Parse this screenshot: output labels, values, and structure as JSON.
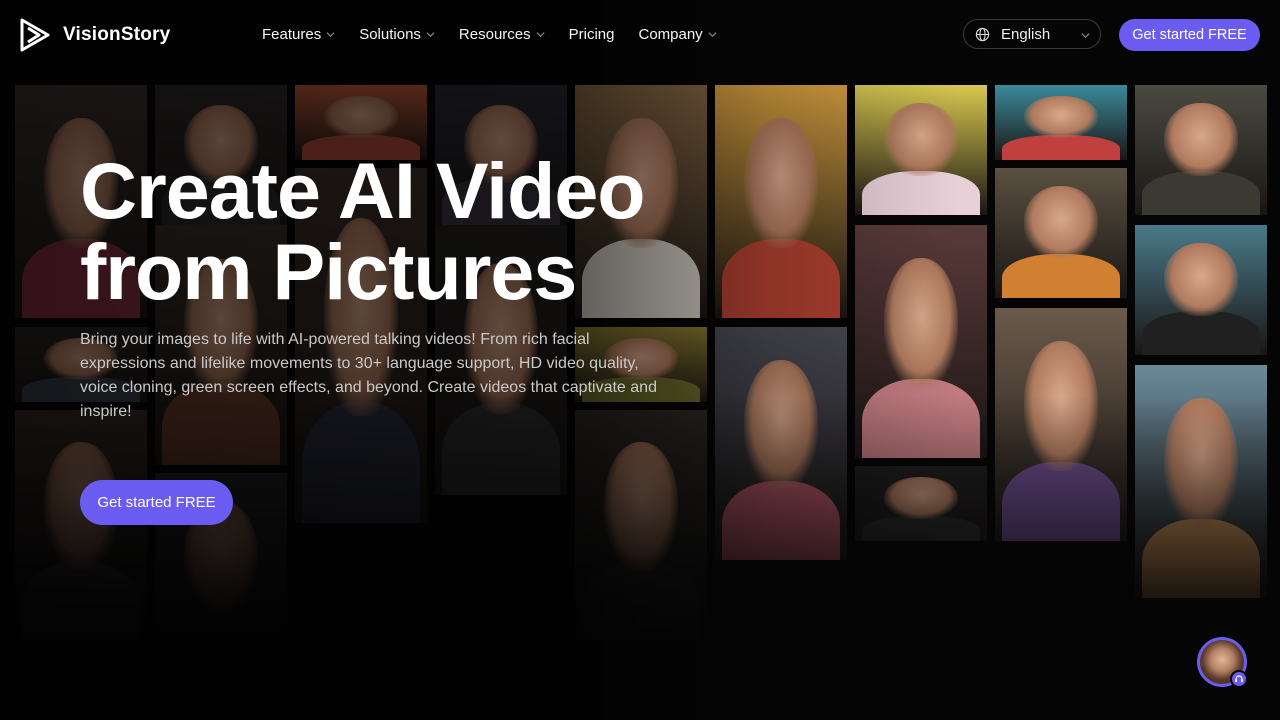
{
  "brand": {
    "name": "VisionStory"
  },
  "nav": {
    "items": [
      {
        "label": "Features",
        "has_dropdown": true
      },
      {
        "label": "Solutions",
        "has_dropdown": true
      },
      {
        "label": "Resources",
        "has_dropdown": true
      },
      {
        "label": "Pricing",
        "has_dropdown": false
      },
      {
        "label": "Company",
        "has_dropdown": true
      }
    ],
    "language": "English",
    "cta_label": "Get started FREE"
  },
  "hero": {
    "title_line1": "Create AI Video",
    "title_line2": "from Pictures",
    "subtitle": "Bring your images to life with AI-powered talking videos! From rich facial expressions and lifelike movements to 30+ language support, HD video quality, voice cloning, green screen effects, and beyond. Create videos that captivate and inspire!",
    "cta_label": "Get started FREE"
  },
  "colors": {
    "accent": "#6a5cf0",
    "background": "#050505"
  },
  "icons": {
    "logo": "play-logo-icon",
    "language": "globe-icon",
    "dropdown": "chevron-down-icon",
    "support": "headset-icon"
  }
}
